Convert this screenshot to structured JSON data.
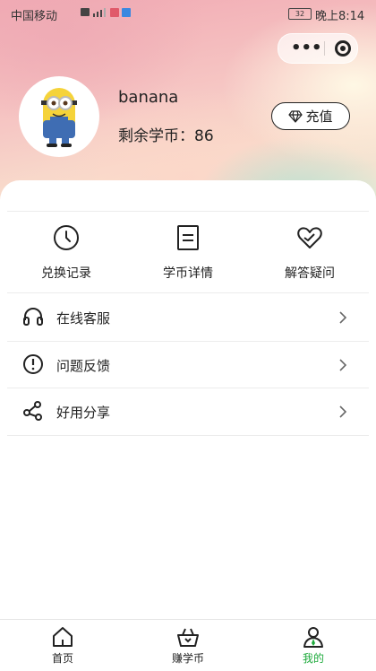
{
  "status_bar": {
    "carrier": "中国移动",
    "time": "晚上8:14",
    "battery": "32"
  },
  "profile": {
    "username": "banana",
    "coins_label": "剩余学币：",
    "coins_value": "86",
    "recharge_label": "充值"
  },
  "quick_actions": [
    {
      "label": "兑换记录",
      "icon": "clock-icon"
    },
    {
      "label": "学币详情",
      "icon": "document-icon"
    },
    {
      "label": "解答疑问",
      "icon": "heart-icon"
    }
  ],
  "menu": [
    {
      "label": "在线客服",
      "icon": "headphones-icon"
    },
    {
      "label": "问题反馈",
      "icon": "alert-circle-icon"
    },
    {
      "label": "好用分享",
      "icon": "share-icon"
    }
  ],
  "tabbar": {
    "items": [
      {
        "label": "首页",
        "icon": "home-icon",
        "active": false
      },
      {
        "label": "赚学币",
        "icon": "basket-icon",
        "active": false
      },
      {
        "label": "我的",
        "icon": "user-icon",
        "active": true
      }
    ],
    "active_color": "#1eaa3c"
  }
}
